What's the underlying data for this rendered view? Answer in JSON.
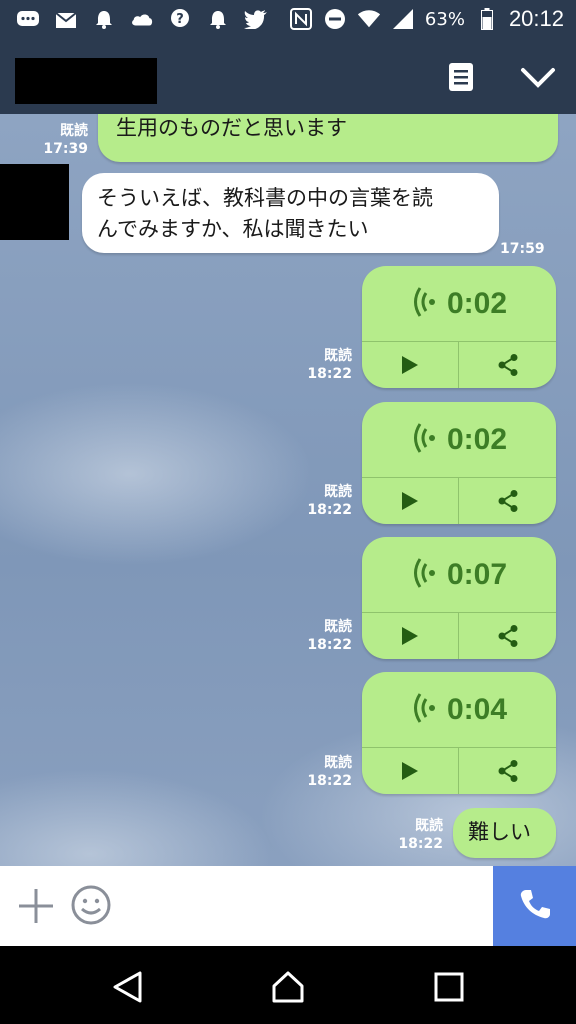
{
  "status_bar": {
    "battery": "63%",
    "time": "20:12",
    "icons": [
      "chat-bubble-icon",
      "mail-icon",
      "alarm-icon",
      "cloud-icon",
      "help-bubble-icon",
      "alarm-icon",
      "twitter-icon",
      "nfc-icon",
      "do-not-disturb-icon",
      "wifi-icon",
      "signal-icon",
      "battery-icon"
    ]
  },
  "header": {
    "menu_icon": "notes-icon",
    "close_icon": "chevron-down-icon"
  },
  "messages": [
    {
      "type": "text",
      "direction": "out",
      "text": "あ、これは大学のWebサイトです。学\n生用のものだと思います",
      "read": "既読",
      "time": "17:39"
    },
    {
      "type": "text",
      "direction": "in",
      "text": "そういえば、教科書の中の言葉を読\nんでみますか、私は聞きたい",
      "time": "17:59"
    },
    {
      "type": "voice",
      "direction": "out",
      "duration": "0:02",
      "read": "既読",
      "time": "18:22"
    },
    {
      "type": "voice",
      "direction": "out",
      "duration": "0:02",
      "read": "既読",
      "time": "18:22"
    },
    {
      "type": "voice",
      "direction": "out",
      "duration": "0:07",
      "read": "既読",
      "time": "18:22"
    },
    {
      "type": "voice",
      "direction": "out",
      "duration": "0:04",
      "read": "既読",
      "time": "18:22"
    },
    {
      "type": "text",
      "direction": "out",
      "text": "難しい",
      "read": "既読",
      "time": "18:22"
    }
  ],
  "colors": {
    "header": "#2b3a4f",
    "bubble_out": "#b6ec8b",
    "voice_accent": "#3d7d26",
    "call_button": "#5580e0"
  }
}
